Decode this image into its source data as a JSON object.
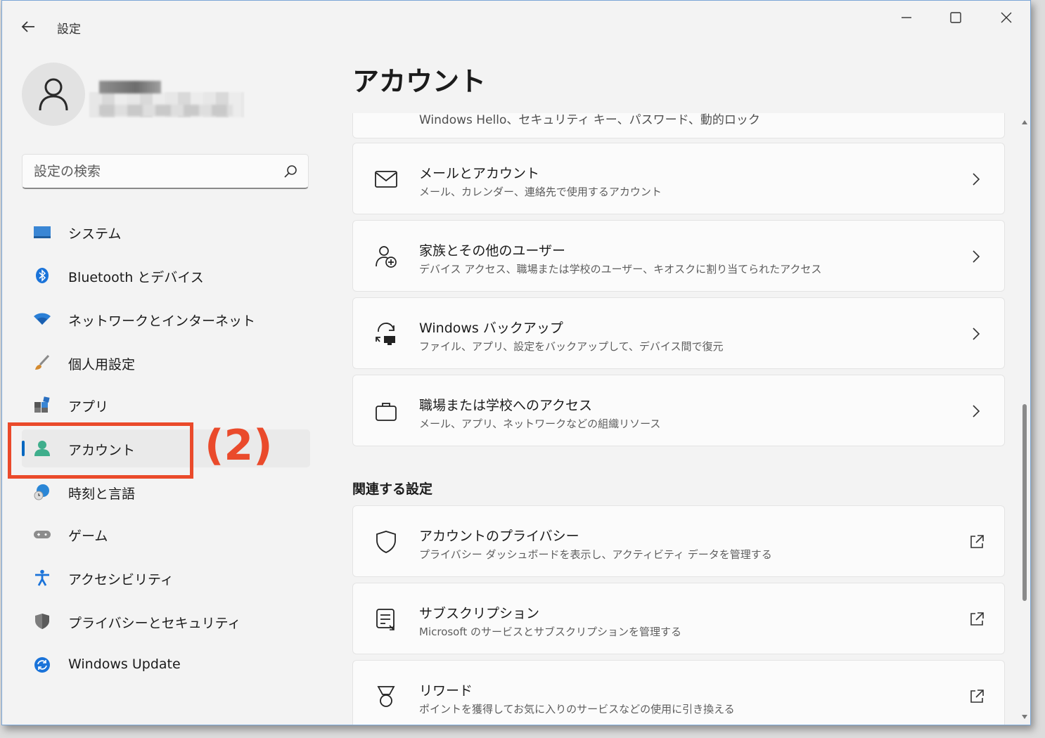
{
  "window": {
    "title": "設定",
    "controls": [
      "minimize-icon",
      "maximize-icon",
      "close-icon"
    ]
  },
  "profile": {
    "avatar_icon": "person-icon"
  },
  "search": {
    "placeholder": "設定の検索",
    "icon": "search-icon"
  },
  "sidebar": {
    "items": [
      {
        "label": "システム",
        "icon": "monitor-icon"
      },
      {
        "label": "Bluetooth とデバイス",
        "icon": "bluetooth-icon"
      },
      {
        "label": "ネットワークとインターネット",
        "icon": "wifi-icon"
      },
      {
        "label": "個人用設定",
        "icon": "brush-icon"
      },
      {
        "label": "アプリ",
        "icon": "apps-icon"
      },
      {
        "label": "アカウント",
        "icon": "account-icon",
        "active": true
      },
      {
        "label": "時刻と言語",
        "icon": "globe-clock-icon"
      },
      {
        "label": "ゲーム",
        "icon": "gamepad-icon"
      },
      {
        "label": "アクセシビリティ",
        "icon": "accessibility-icon"
      },
      {
        "label": "プライバシーとセキュリティ",
        "icon": "shield-icon"
      },
      {
        "label": "Windows Update",
        "icon": "update-icon"
      }
    ]
  },
  "annotation": {
    "label": "(2)",
    "color": "#ea4a2b"
  },
  "main": {
    "title": "アカウント",
    "partial_card_sub": "Windows Hello、セキュリティ キー、パスワード、動的ロック",
    "cards": [
      {
        "title": "メールとアカウント",
        "sub": "メール、カレンダー、連絡先で使用するアカウント",
        "icon": "mail-icon"
      },
      {
        "title": "家族とその他のユーザー",
        "sub": "デバイス アクセス、職場または学校のユーザー、キオスクに割り当てられたアクセス",
        "icon": "family-icon"
      },
      {
        "title": "Windows バックアップ",
        "sub": "ファイル、アプリ、設定をバックアップして、デバイス間で復元",
        "icon": "backup-icon"
      },
      {
        "title": "職場または学校へのアクセス",
        "sub": "メール、アプリ、ネットワークなどの組織リソース",
        "icon": "briefcase-icon"
      }
    ],
    "related_heading": "関連する設定",
    "related": [
      {
        "title": "アカウントのプライバシー",
        "sub": "プライバシー ダッシュボードを表示し、アクティビティ データを管理する",
        "icon": "shield-outline-icon"
      },
      {
        "title": "サブスクリプション",
        "sub": "Microsoft のサービスとサブスクリプションを管理する",
        "icon": "subscription-icon"
      },
      {
        "title": "リワード",
        "sub": "ポイントを獲得してお気に入りのサービスなどの使用に引き換える",
        "icon": "reward-icon"
      }
    ]
  },
  "colors": {
    "accent": "#0067c0",
    "background": "#f3f3f3",
    "card": "#fbfbfb"
  }
}
